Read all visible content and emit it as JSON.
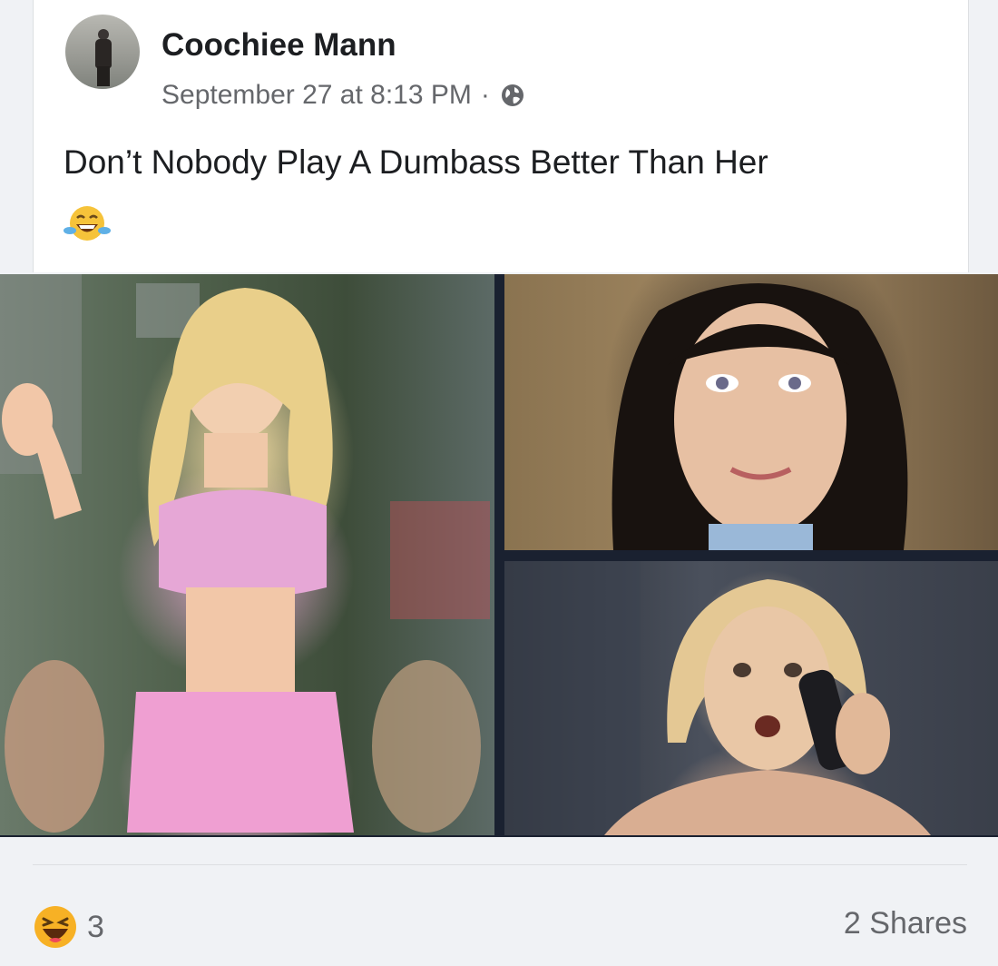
{
  "post": {
    "author": "Coochiee Mann",
    "timestamp": "September 27 at 8:13 PM",
    "separator": "·",
    "privacy_icon": "globe-icon",
    "text": "Don’t Nobody Play A Dumbass Better Than Her",
    "text_emoji": "face-with-tears-of-joy-emoji"
  },
  "photos": [
    {
      "name": "photo-woman-pink-outfit-waving"
    },
    {
      "name": "photo-woman-dark-bob-hair"
    },
    {
      "name": "photo-woman-blonde-on-phone"
    }
  ],
  "footer": {
    "reaction_icon": "haha-reaction-icon",
    "reaction_count": "3",
    "shares": "2 Shares"
  },
  "colors": {
    "background": "#f0f2f5",
    "card": "#ffffff",
    "text_primary": "#1c1e21",
    "text_secondary": "#65676b",
    "reaction_yellow": "#f7b125"
  }
}
